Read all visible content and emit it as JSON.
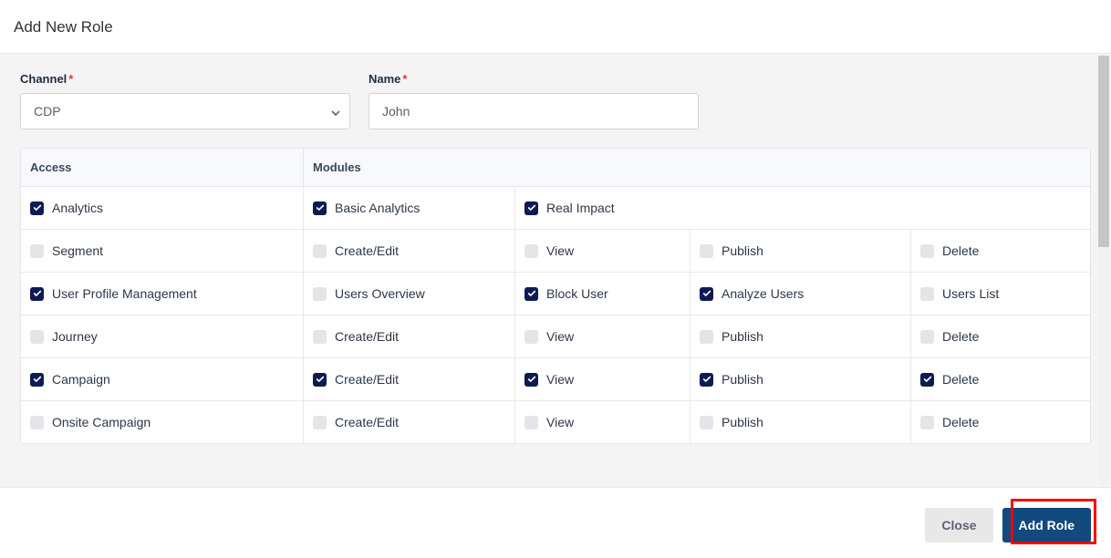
{
  "header": {
    "title": "Add New Role"
  },
  "form": {
    "channel_label": "Channel",
    "channel_value": "CDP",
    "name_label": "Name",
    "name_value": "John"
  },
  "table": {
    "head_access": "Access",
    "head_modules": "Modules",
    "rows": [
      {
        "access": {
          "label": "Analytics",
          "checked": true
        },
        "modules": [
          {
            "label": "Basic Analytics",
            "checked": true
          },
          {
            "label": "Real Impact",
            "checked": true
          }
        ]
      },
      {
        "access": {
          "label": "Segment",
          "checked": false
        },
        "modules": [
          {
            "label": "Create/Edit",
            "checked": false
          },
          {
            "label": "View",
            "checked": false
          },
          {
            "label": "Publish",
            "checked": false
          },
          {
            "label": "Delete",
            "checked": false
          }
        ]
      },
      {
        "access": {
          "label": "User Profile Management",
          "checked": true
        },
        "modules": [
          {
            "label": "Users Overview",
            "checked": false
          },
          {
            "label": "Block User",
            "checked": true
          },
          {
            "label": "Analyze Users",
            "checked": true
          },
          {
            "label": "Users List",
            "checked": false
          }
        ]
      },
      {
        "access": {
          "label": "Journey",
          "checked": false
        },
        "modules": [
          {
            "label": "Create/Edit",
            "checked": false
          },
          {
            "label": "View",
            "checked": false
          },
          {
            "label": "Publish",
            "checked": false
          },
          {
            "label": "Delete",
            "checked": false
          }
        ]
      },
      {
        "access": {
          "label": "Campaign",
          "checked": true
        },
        "modules": [
          {
            "label": "Create/Edit",
            "checked": true
          },
          {
            "label": "View",
            "checked": true
          },
          {
            "label": "Publish",
            "checked": true
          },
          {
            "label": "Delete",
            "checked": true
          }
        ]
      },
      {
        "access": {
          "label": "Onsite Campaign",
          "checked": false
        },
        "modules": [
          {
            "label": "Create/Edit",
            "checked": false
          },
          {
            "label": "View",
            "checked": false
          },
          {
            "label": "Publish",
            "checked": false
          },
          {
            "label": "Delete",
            "checked": false
          }
        ]
      }
    ]
  },
  "footer": {
    "close_label": "Close",
    "add_label": "Add Role"
  }
}
